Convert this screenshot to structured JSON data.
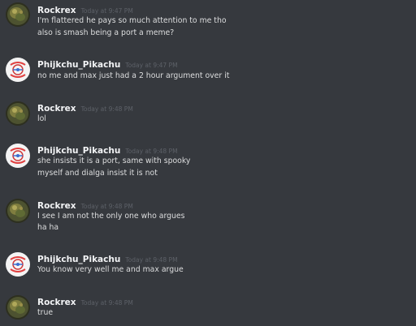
{
  "colors": {
    "background": "#36393e",
    "username": "#f2f3f5",
    "message_text": "#dcddde",
    "timestamp": "#5d6168"
  },
  "messages": [
    {
      "author": "Rockrex",
      "avatar_icon": "rockrex-avatar-icon",
      "timestamp": "Today at 9:47 PM",
      "lines": [
        "I'm flattered he pays so much attention to me tho",
        "also is smash being a port a meme?"
      ]
    },
    {
      "author": "Phijkchu_Pikachu",
      "avatar_icon": "pokeball-avatar-icon",
      "timestamp": "Today at 9:47 PM",
      "lines": [
        "no me and max just had a 2 hour argument over it"
      ]
    },
    {
      "author": "Rockrex",
      "avatar_icon": "rockrex-avatar-icon",
      "timestamp": "Today at 9:48 PM",
      "lines": [
        "lol"
      ]
    },
    {
      "author": "Phijkchu_Pikachu",
      "avatar_icon": "pokeball-avatar-icon",
      "timestamp": "Today at 9:48 PM",
      "lines": [
        "she insists it is a port, same with spooky",
        "myself and dialga insist it is not"
      ]
    },
    {
      "author": "Rockrex",
      "avatar_icon": "rockrex-avatar-icon",
      "timestamp": "Today at 9:48 PM",
      "lines": [
        "I see I am not the only one who argues",
        "ha ha"
      ]
    },
    {
      "author": "Phijkchu_Pikachu",
      "avatar_icon": "pokeball-avatar-icon",
      "timestamp": "Today at 9:48 PM",
      "lines": [
        "You know very well me and max argue"
      ]
    },
    {
      "author": "Rockrex",
      "avatar_icon": "rockrex-avatar-icon",
      "timestamp": "Today at 9:48 PM",
      "lines": [
        "true"
      ]
    }
  ]
}
